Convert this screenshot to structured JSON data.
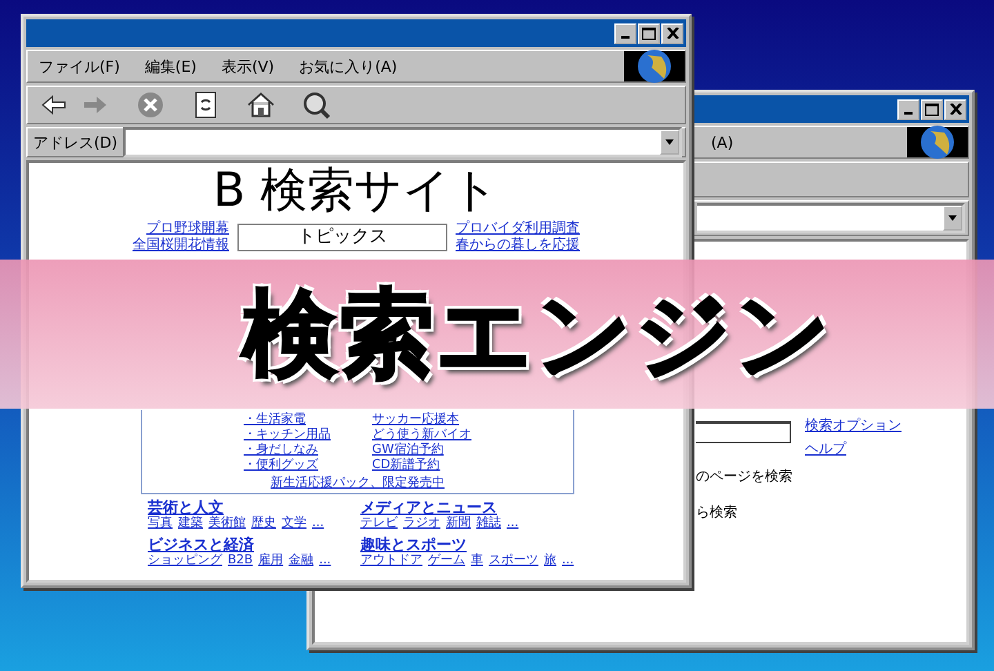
{
  "back_window": {
    "menu": [
      "(A)"
    ],
    "links": [
      "検索オプション",
      "ヘルプ"
    ],
    "texts": [
      "のページを検索",
      "ら検索"
    ]
  },
  "front_window": {
    "menu": [
      "ファイル(F)",
      "編集(E)",
      "表示(V)",
      "お気に入り(A)"
    ],
    "address_label": "アドレス(D)",
    "site_title": "B 検索サイト",
    "left_links": [
      "プロ野球開幕",
      "全国桜開花情報"
    ],
    "topics_label": "トピックス",
    "right_links": [
      "プロバイダ利用調査",
      "春からの暮しを応援"
    ],
    "promo": {
      "column_1": [
        "・生活家電",
        "・キッチン用品",
        "・身だしなみ",
        "・便利グッズ"
      ],
      "column_2": [
        "サッカー応援本",
        "どう使う新バイオ",
        "GW宿泊予約",
        "CD新譜予約"
      ],
      "footer": "新生活応援パック、限定発売中"
    },
    "categories": [
      {
        "title": "芸術と人文",
        "items": [
          "写真",
          "建築",
          "美術館",
          "歴史",
          "文学",
          "..."
        ]
      },
      {
        "title": "メディアとニュース",
        "items": [
          "テレビ",
          "ラジオ",
          "新聞",
          "雑誌",
          "..."
        ]
      },
      {
        "title": "ビジネスと経済",
        "items": [
          "ショッピング",
          "B2B",
          "雇用",
          "金融",
          "..."
        ]
      },
      {
        "title": "趣味とスポーツ",
        "items": [
          "アウトドア",
          "ゲーム",
          "車",
          "スポーツ",
          "旅",
          "..."
        ]
      }
    ]
  },
  "banner": {
    "title": "検索エンジン"
  }
}
